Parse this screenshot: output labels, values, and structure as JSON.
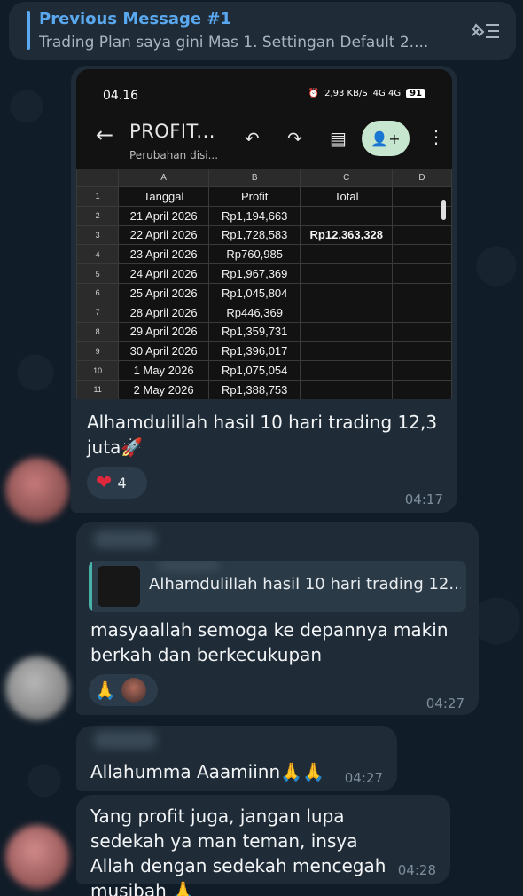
{
  "pinned": {
    "title": "Previous Message #1",
    "preview": "Trading Plan saya gini Mas 1. Settingan Default  2...."
  },
  "message1": {
    "screenshot": {
      "status_time": "04.16",
      "status_speed": "2,93 KB/S",
      "status_net": "4G 4G",
      "battery": "91",
      "sheet_title": "PROFIT...",
      "sheet_subtitle": "Perubahan disi...",
      "columns": [
        "",
        "A",
        "B",
        "C",
        "D"
      ],
      "rows": [
        {
          "n": "1",
          "a": "Tanggal",
          "b": "Profit",
          "c": "Total"
        },
        {
          "n": "2",
          "a": "21 April 2026",
          "b": "Rp1,194,663",
          "c": ""
        },
        {
          "n": "3",
          "a": "22 April 2026",
          "b": "Rp1,728,583",
          "c": "Rp12,363,328"
        },
        {
          "n": "4",
          "a": "23 April 2026",
          "b": "Rp760,985",
          "c": ""
        },
        {
          "n": "5",
          "a": "24 April 2026",
          "b": "Rp1,967,369",
          "c": ""
        },
        {
          "n": "6",
          "a": "25 April 2026",
          "b": "Rp1,045,804",
          "c": ""
        },
        {
          "n": "7",
          "a": "28 April 2026",
          "b": "Rp446,369",
          "c": ""
        },
        {
          "n": "8",
          "a": "29 April 2026",
          "b": "Rp1,359,731",
          "c": ""
        },
        {
          "n": "9",
          "a": "30 April 2026",
          "b": "Rp1,396,017",
          "c": ""
        },
        {
          "n": "10",
          "a": "1 May 2026",
          "b": "Rp1,075,054",
          "c": ""
        },
        {
          "n": "11",
          "a": "2 May 2026",
          "b": "Rp1,388,753",
          "c": ""
        }
      ]
    },
    "caption": "Alhamdulillah hasil 10 hari trading 12,3 juta🚀",
    "reaction_count": "4",
    "time": "04:17"
  },
  "message2": {
    "reply_text": "Alhamdulillah hasil 10 hari trading 12...",
    "text": "masyaallah semoga ke depannya makin berkah dan berkecukupan",
    "reaction": "🙏",
    "time": "04:27"
  },
  "message3": {
    "text": "Allahumma Aaamiinn🙏🙏",
    "time": "04:27"
  },
  "message4": {
    "text": "Yang profit juga, jangan lupa sedekah ya man teman, insya Allah dengan sedekah mencegah musibah 🙏",
    "time": "04:28"
  },
  "colors": {
    "accent": "#5aa8f0",
    "bubble": "#1f2c38",
    "background": "#101c28",
    "reply_bar": "#47b3a8"
  },
  "icons": [
    "unpin-list-icon",
    "back-arrow-icon",
    "undo-icon",
    "redo-icon",
    "comment-icon",
    "add-person-icon",
    "more-vert-icon",
    "heart-icon",
    "pray-icon"
  ]
}
